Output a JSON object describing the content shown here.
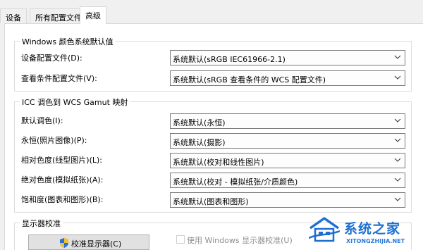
{
  "tabs": [
    "设备",
    "所有配置文件",
    "高级"
  ],
  "active_tab": "高级",
  "group_windows": {
    "title": "Windows 颜色系统默认值",
    "rows": [
      {
        "label": "设备配置文件(D):",
        "value": "系统默认(sRGB IEC61966-2.1)"
      },
      {
        "label": "查看条件配置文件(V):",
        "value": "系统默认(sRGB 查看条件的 WCS 配置文件)"
      }
    ]
  },
  "group_icc": {
    "title": "ICC 调色到 WCS Gamut 映射",
    "rows": [
      {
        "label": "默认调色(I):",
        "value": "系统默认(永恒)"
      },
      {
        "label": "永恒(照片图像)(P):",
        "value": "系统默认(摄影)"
      },
      {
        "label": "相对色度(线型图片)(L):",
        "value": "系统默认(校对和线性图片)"
      },
      {
        "label": "绝对色度(模拟纸张)(A):",
        "value": "系统默认(校对 - 模拟纸张/介质颜色)"
      },
      {
        "label": "饱和度(图表和图形)(B):",
        "value": "系统默认(图表和图形)"
      }
    ]
  },
  "group_calibration": {
    "title": "显示器校准",
    "button_label": "校准显示器(C)",
    "checkbox_label": "使用 Windows 显示器校准(U)",
    "checkbox_checked": false
  },
  "watermark": {
    "title": "系统之家",
    "url": "XITONGZHIJIA.NET",
    "color": "#1d6fd0"
  }
}
